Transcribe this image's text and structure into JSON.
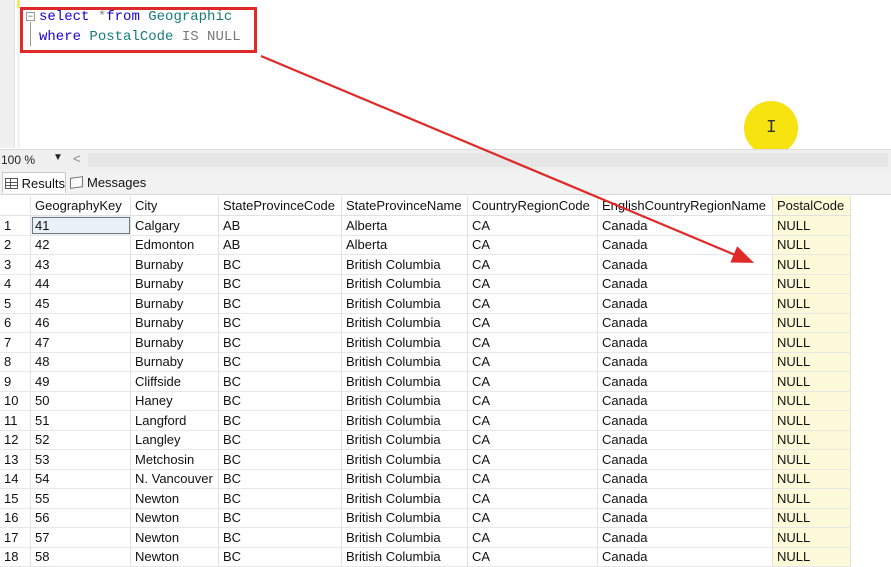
{
  "editor": {
    "line1": {
      "kw1": "select",
      "op": " *",
      "kw2": "from",
      "table": " Geographic"
    },
    "line2": {
      "kw1": "where",
      "col": " PostalCode",
      "cond": " IS NULL"
    }
  },
  "zoom": {
    "level": "100 %"
  },
  "tabs": {
    "results": "Results",
    "messages": "Messages"
  },
  "grid": {
    "columns": [
      "",
      "GeographyKey",
      "City",
      "StateProvinceCode",
      "StateProvinceName",
      "CountryRegionCode",
      "EnglishCountryRegionName",
      "PostalCode"
    ],
    "rows": [
      [
        "1",
        "41",
        "Calgary",
        "AB",
        "Alberta",
        "CA",
        "Canada",
        "NULL"
      ],
      [
        "2",
        "42",
        "Edmonton",
        "AB",
        "Alberta",
        "CA",
        "Canada",
        "NULL"
      ],
      [
        "3",
        "43",
        "Burnaby",
        "BC",
        "British Columbia",
        "CA",
        "Canada",
        "NULL"
      ],
      [
        "4",
        "44",
        "Burnaby",
        "BC",
        "British Columbia",
        "CA",
        "Canada",
        "NULL"
      ],
      [
        "5",
        "45",
        "Burnaby",
        "BC",
        "British Columbia",
        "CA",
        "Canada",
        "NULL"
      ],
      [
        "6",
        "46",
        "Burnaby",
        "BC",
        "British Columbia",
        "CA",
        "Canada",
        "NULL"
      ],
      [
        "7",
        "47",
        "Burnaby",
        "BC",
        "British Columbia",
        "CA",
        "Canada",
        "NULL"
      ],
      [
        "8",
        "48",
        "Burnaby",
        "BC",
        "British Columbia",
        "CA",
        "Canada",
        "NULL"
      ],
      [
        "9",
        "49",
        "Cliffside",
        "BC",
        "British Columbia",
        "CA",
        "Canada",
        "NULL"
      ],
      [
        "10",
        "50",
        "Haney",
        "BC",
        "British Columbia",
        "CA",
        "Canada",
        "NULL"
      ],
      [
        "11",
        "51",
        "Langford",
        "BC",
        "British Columbia",
        "CA",
        "Canada",
        "NULL"
      ],
      [
        "12",
        "52",
        "Langley",
        "BC",
        "British Columbia",
        "CA",
        "Canada",
        "NULL"
      ],
      [
        "13",
        "53",
        "Metchosin",
        "BC",
        "British Columbia",
        "CA",
        "Canada",
        "NULL"
      ],
      [
        "14",
        "54",
        "N. Vancouver",
        "BC",
        "British Columbia",
        "CA",
        "Canada",
        "NULL"
      ],
      [
        "15",
        "55",
        "Newton",
        "BC",
        "British Columbia",
        "CA",
        "Canada",
        "NULL"
      ],
      [
        "16",
        "56",
        "Newton",
        "BC",
        "British Columbia",
        "CA",
        "Canada",
        "NULL"
      ],
      [
        "17",
        "57",
        "Newton",
        "BC",
        "British Columbia",
        "CA",
        "Canada",
        "NULL"
      ],
      [
        "18",
        "58",
        "Newton",
        "BC",
        "British Columbia",
        "CA",
        "Canada",
        "NULL"
      ]
    ]
  },
  "colors": {
    "highlight_box": "#e02929",
    "arrow": "#e02929",
    "cursor_highlight": "#f7e30f",
    "postal_column_bg": "#fdfad9"
  }
}
